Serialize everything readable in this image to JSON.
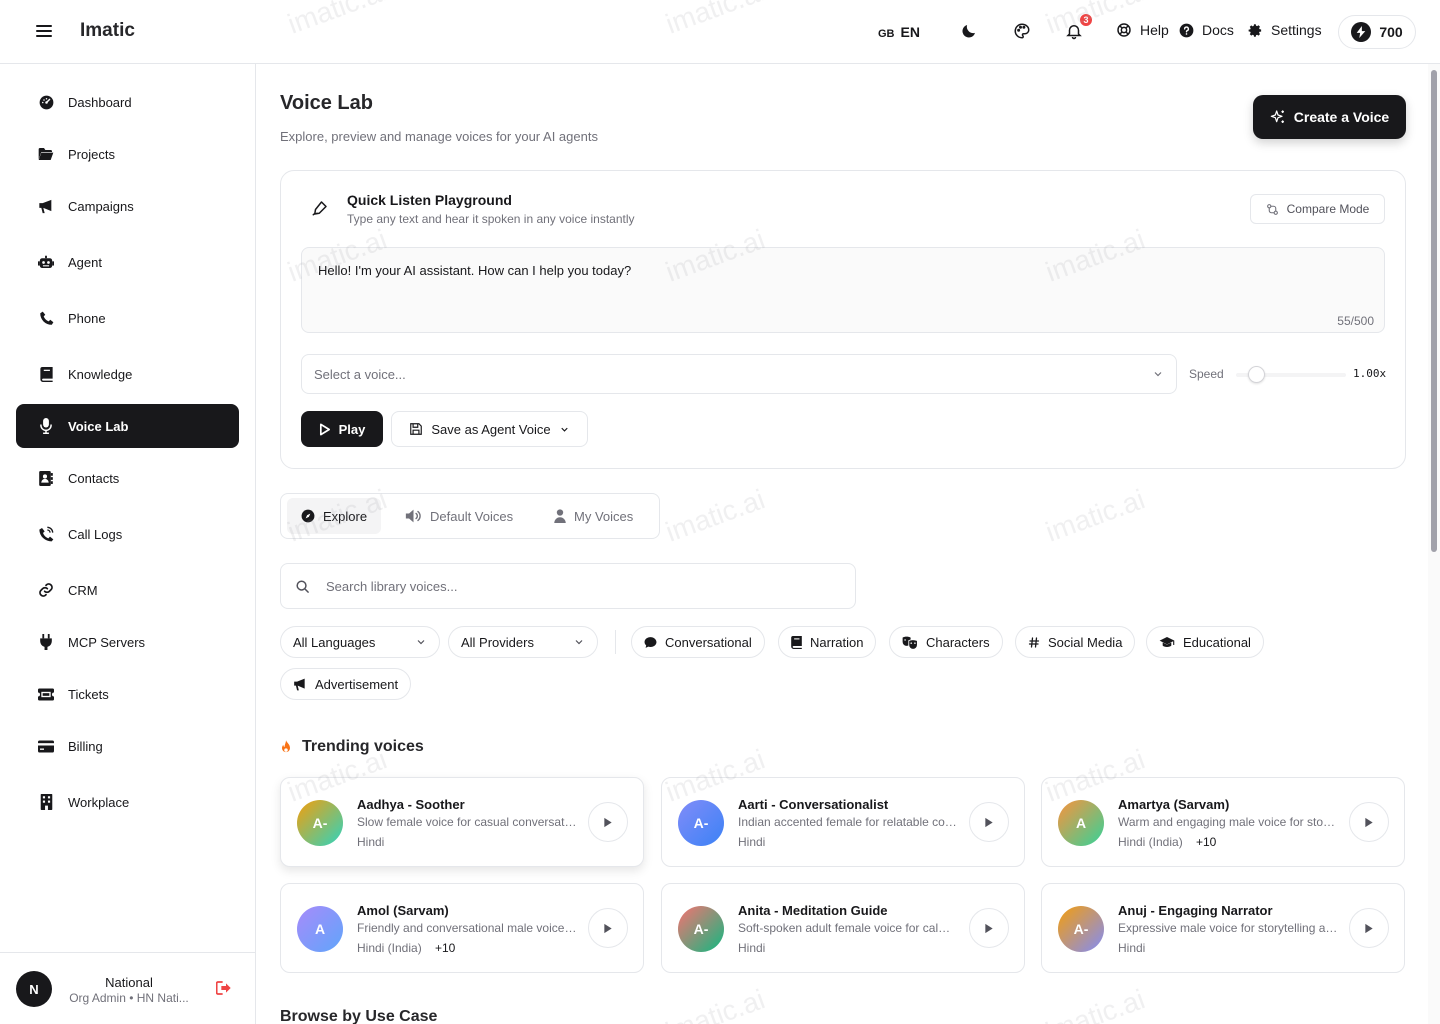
{
  "app": {
    "brand": "Imatic"
  },
  "header": {
    "lang_flag": "GB",
    "lang_code": "EN",
    "notifications_count": "3",
    "help": "Help",
    "docs": "Docs",
    "settings": "Settings",
    "credits": "700"
  },
  "sidebar": {
    "items": [
      {
        "label": "Dashboard",
        "icon": "dashboard-icon"
      },
      {
        "label": "Projects",
        "icon": "folder-icon"
      },
      {
        "label": "Campaigns",
        "icon": "megaphone-icon"
      },
      {
        "label": "Agent",
        "icon": "robot-icon"
      },
      {
        "label": "Phone",
        "icon": "phone-icon"
      },
      {
        "label": "Knowledge",
        "icon": "book-icon"
      },
      {
        "label": "Voice Lab",
        "icon": "microphone-icon",
        "active": true
      },
      {
        "label": "Contacts",
        "icon": "contacts-icon"
      },
      {
        "label": "Call Logs",
        "icon": "call-log-icon"
      },
      {
        "label": "CRM",
        "icon": "link-icon"
      },
      {
        "label": "MCP Servers",
        "icon": "plug-icon"
      },
      {
        "label": "Tickets",
        "icon": "ticket-icon"
      },
      {
        "label": "Billing",
        "icon": "credit-card-icon"
      },
      {
        "label": "Workplace",
        "icon": "building-icon"
      }
    ],
    "user": {
      "initial": "N",
      "name": "National",
      "role": "Org Admin • HN Nati..."
    }
  },
  "page": {
    "title": "Voice Lab",
    "subtitle": "Explore, preview and manage voices for your AI agents",
    "create_button": "Create a Voice"
  },
  "playground": {
    "title": "Quick Listen Playground",
    "subtitle": "Type any text and hear it spoken in any voice instantly",
    "compare_mode": "Compare Mode",
    "text": "Hello! I'm your AI assistant. How can I help you today?",
    "char_count": "55/500",
    "voice_placeholder": "Select a voice...",
    "speed_label": "Speed",
    "speed_value": "1.00x",
    "speed_level": 0.18,
    "play": "Play",
    "save_agent_voice": "Save as Agent Voice"
  },
  "tabs": [
    {
      "label": "Explore",
      "active": true
    },
    {
      "label": "Default Voices"
    },
    {
      "label": "My Voices"
    }
  ],
  "search": {
    "placeholder": "Search library voices..."
  },
  "filters": {
    "languages": "All Languages",
    "providers": "All Providers"
  },
  "categories": [
    "Conversational",
    "Narration",
    "Characters",
    "Social Media",
    "Educational",
    "Advertisement"
  ],
  "trending": {
    "title": "Trending voices",
    "voices": [
      {
        "initials": "A-",
        "name": "Aadhya - Soother",
        "desc": "Slow female voice for casual conversation",
        "lang": "Hindi",
        "extra": ""
      },
      {
        "initials": "A-",
        "name": "Aarti - Conversationalist",
        "desc": "Indian accented female for relatable conversations",
        "lang": "Hindi",
        "extra": ""
      },
      {
        "initials": "A",
        "name": "Amartya (Sarvam)",
        "desc": "Warm and engaging male voice for storytelling",
        "lang": "Hindi (India)",
        "extra": "+10"
      },
      {
        "initials": "A",
        "name": "Amol (Sarvam)",
        "desc": "Friendly and conversational male voice for agents",
        "lang": "Hindi (India)",
        "extra": "+10"
      },
      {
        "initials": "A-",
        "name": "Anita - Meditation Guide",
        "desc": "Soft-spoken adult female voice for calm meditation",
        "lang": "Hindi",
        "extra": ""
      },
      {
        "initials": "A-",
        "name": "Anuj - Engaging Narrator",
        "desc": "Expressive male voice for storytelling and narration",
        "lang": "Hindi",
        "extra": ""
      }
    ]
  },
  "browse": {
    "title": "Browse by Use Case"
  },
  "watermark": "imatic.ai"
}
